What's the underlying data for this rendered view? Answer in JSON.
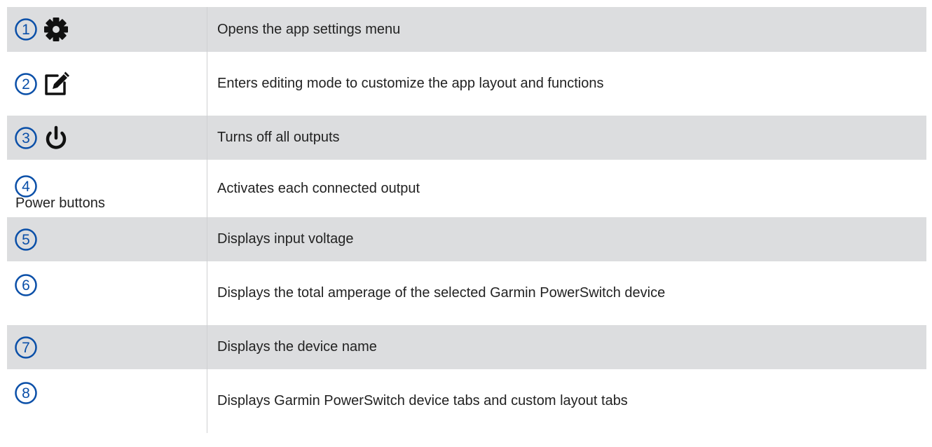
{
  "rows": [
    {
      "callout": "1",
      "icon": "gear-icon",
      "key_label": "",
      "description": "Opens the app settings menu"
    },
    {
      "callout": "2",
      "icon": "edit-icon",
      "key_label": "",
      "description": "Enters editing mode to customize the app layout and functions"
    },
    {
      "callout": "3",
      "icon": "power-icon",
      "key_label": "",
      "description": "Turns off all outputs"
    },
    {
      "callout": "4",
      "icon": "",
      "key_label": "Power buttons",
      "description": "Activates each connected output"
    },
    {
      "callout": "5",
      "icon": "",
      "key_label": "",
      "description": "Displays input voltage"
    },
    {
      "callout": "6",
      "icon": "",
      "key_label": "",
      "description": "Displays the total amperage of the selected Garmin PowerSwitch device"
    },
    {
      "callout": "7",
      "icon": "",
      "key_label": "",
      "description": "Displays the device name"
    },
    {
      "callout": "8",
      "icon": "",
      "key_label": "",
      "description": "Displays Garmin PowerSwitch device tabs and custom layout tabs"
    }
  ],
  "colors": {
    "callout": "#0a4fa8",
    "icon": "#111111",
    "row_shade": "#dcdddf",
    "text": "#222222"
  }
}
